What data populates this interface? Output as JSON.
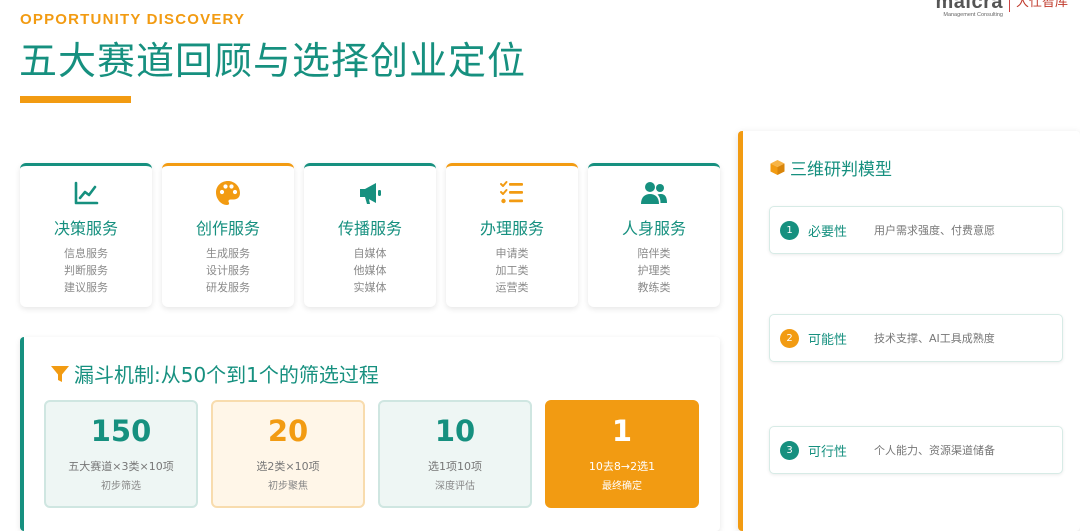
{
  "header": {
    "eyebrow": "OPPORTUNITY DISCOVERY",
    "title": "五大赛道回顾与选择创业定位"
  },
  "logo": {
    "word": "maicra",
    "sub": "Management Consulting",
    "cn": "大仕智库"
  },
  "colors": {
    "teal": "#16907f",
    "orange": "#f29b12"
  },
  "services": [
    {
      "icon": "chart-line-icon",
      "title": "决策服务",
      "items": [
        "信息服务",
        "判断服务",
        "建议服务"
      ]
    },
    {
      "icon": "palette-icon",
      "title": "创作服务",
      "items": [
        "生成服务",
        "设计服务",
        "研发服务"
      ]
    },
    {
      "icon": "megaphone-icon",
      "title": "传播服务",
      "items": [
        "自媒体",
        "他媒体",
        "实媒体"
      ]
    },
    {
      "icon": "list-check-icon",
      "title": "办理服务",
      "items": [
        "申请类",
        "加工类",
        "运营类"
      ]
    },
    {
      "icon": "people-icon",
      "title": "人身服务",
      "items": [
        "陪伴类",
        "护理类",
        "教练类"
      ]
    }
  ],
  "funnel": {
    "title": "漏斗机制:从50个到1个的筛选过程",
    "stages": [
      {
        "number": "150",
        "line1": "五大赛道×3类×10项",
        "line2": "初步筛选"
      },
      {
        "number": "20",
        "line1": "选2类×10项",
        "line2": "初步聚焦"
      },
      {
        "number": "10",
        "line1": "选1项10项",
        "line2": "深度评估"
      },
      {
        "number": "1",
        "line1": "10去8→2选1",
        "line2": "最终确定"
      }
    ]
  },
  "model": {
    "title": "三维研判模型",
    "criteria": [
      {
        "num": "1",
        "label": "必要性",
        "desc": "用户需求强度、付费意愿"
      },
      {
        "num": "2",
        "label": "可能性",
        "desc": "技术支撑、AI工具成熟度"
      },
      {
        "num": "3",
        "label": "可行性",
        "desc": "个人能力、资源渠道储备"
      }
    ]
  }
}
